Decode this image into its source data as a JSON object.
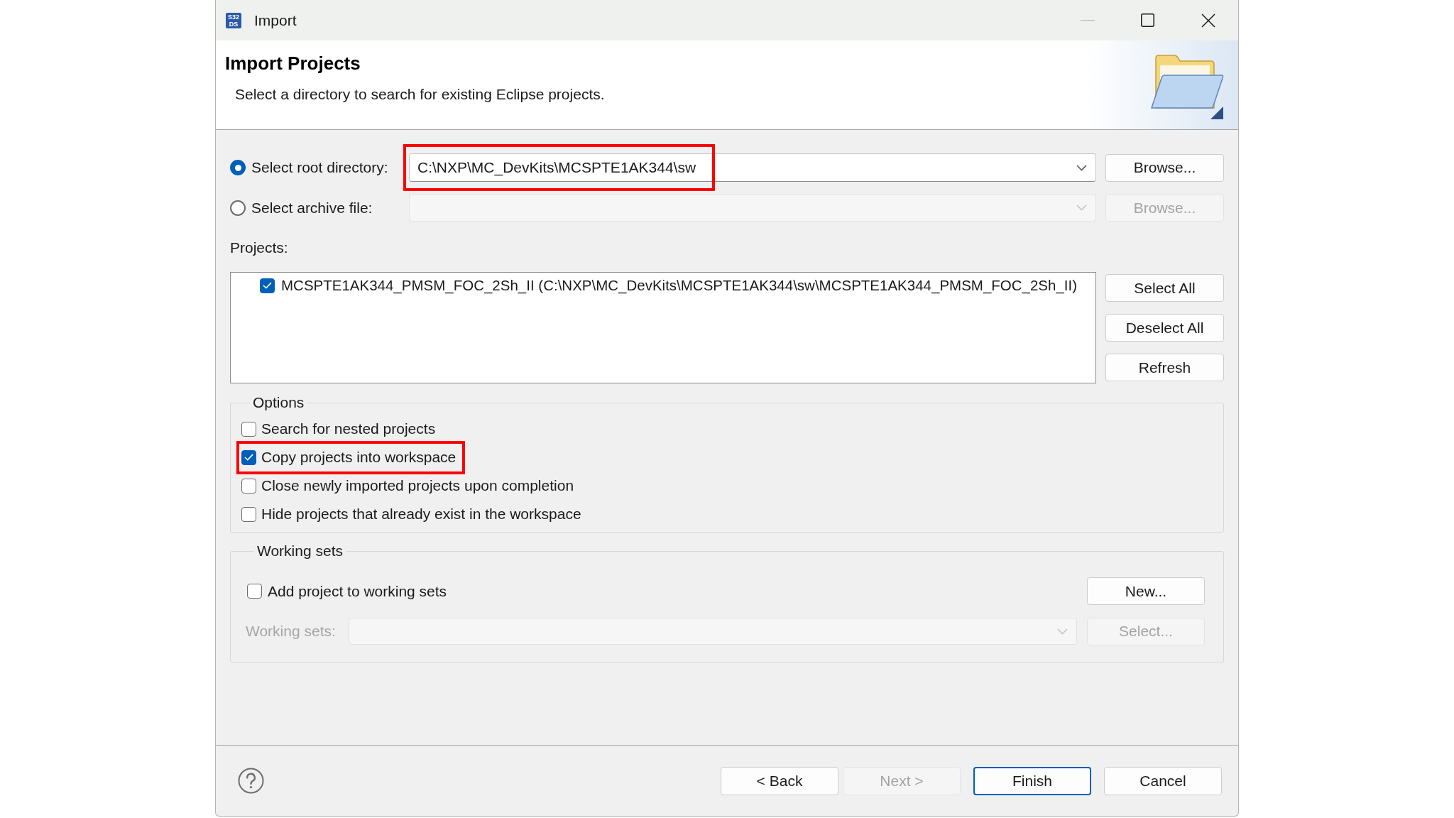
{
  "window": {
    "logo": [
      "S32",
      "DS"
    ],
    "title": "Import",
    "minimize_disabled": true
  },
  "header": {
    "title": "Import Projects",
    "description": "Select a directory to search for existing Eclipse projects."
  },
  "sources": [
    {
      "label": "Select root directory:",
      "selected": true,
      "value": "C:\\NXP\\MC_DevKits\\MCSPTE1AK344\\sw",
      "disabled": false,
      "highlighted": true,
      "browse": {
        "label": "Browse...",
        "disabled": false
      }
    },
    {
      "label": "Select archive file:",
      "selected": false,
      "disabled": true,
      "highlighted": false,
      "browse": {
        "label": "Browse...",
        "disabled": true
      }
    }
  ],
  "projects": {
    "label": "Projects:",
    "items": [
      {
        "label": "MCSPTE1AK344_PMSM_FOC_2Sh_II (C:\\NXP\\MC_DevKits\\MCSPTE1AK344\\sw\\MCSPTE1AK344_PMSM_FOC_2Sh_II)",
        "checked": true
      }
    ],
    "buttons": [
      {
        "label": "Select All"
      },
      {
        "label": "Deselect All"
      },
      {
        "label": "Refresh"
      }
    ]
  },
  "options": {
    "title": "Options",
    "items": [
      {
        "label": "Search for nested projects",
        "checked": false,
        "highlighted": false
      },
      {
        "label": "Copy projects into workspace",
        "checked": true,
        "highlighted": true
      },
      {
        "label": "Close newly imported projects upon completion",
        "checked": false,
        "highlighted": false
      },
      {
        "label": "Hide projects that already exist in the workspace",
        "checked": false,
        "highlighted": false
      }
    ]
  },
  "working_sets": {
    "title": "Working sets",
    "add": {
      "label": "Add project to working sets",
      "checked": false
    },
    "new_button": {
      "label": "New...",
      "disabled": false
    },
    "field": {
      "label": "Working sets:",
      "disabled": true
    },
    "select_button": {
      "label": "Select...",
      "disabled": true
    }
  },
  "footer": {
    "buttons": [
      {
        "label": "< Back",
        "disabled": false,
        "default": false
      },
      {
        "label": "Next >",
        "disabled": true,
        "default": false
      },
      {
        "label": "Finish",
        "disabled": false,
        "default": true
      },
      {
        "label": "Cancel",
        "disabled": false,
        "default": false
      }
    ]
  }
}
